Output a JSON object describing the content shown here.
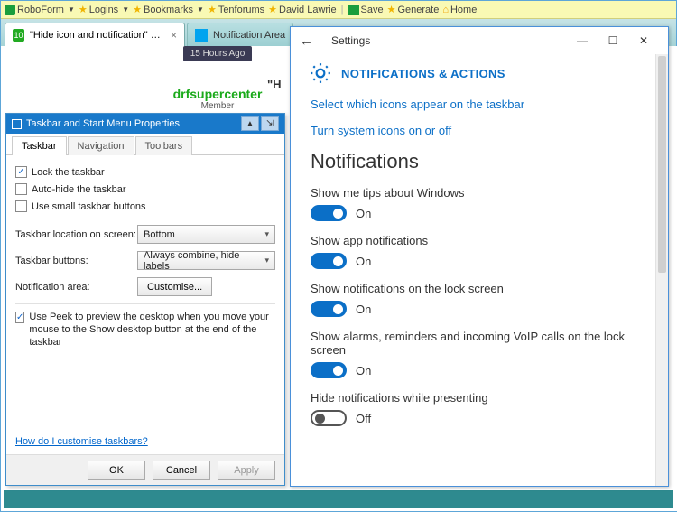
{
  "toolbar": {
    "items": [
      "RoboForm",
      "Logins",
      "Bookmarks",
      "Tenforums",
      "David Lawrie",
      "Save",
      "Generate",
      "Home"
    ]
  },
  "tabs": {
    "active": "\"Hide icon and notification\" optio...",
    "inactive": "Notification Area"
  },
  "forum": {
    "time": "15 Hours Ago",
    "user": "drfsupercenter",
    "role": "Member",
    "quote_prefix": "\"H"
  },
  "props": {
    "title": "Taskbar and Start Menu Properties",
    "tabs": [
      "Taskbar",
      "Navigation",
      "Toolbars"
    ],
    "lock": "Lock the taskbar",
    "autohide": "Auto-hide the taskbar",
    "small": "Use small taskbar buttons",
    "loc_label": "Taskbar location on screen:",
    "loc_value": "Bottom",
    "btns_label": "Taskbar buttons:",
    "btns_value": "Always combine, hide labels",
    "notif_label": "Notification area:",
    "notif_btn": "Customise...",
    "peek": "Use Peek to preview the desktop when you move your mouse to the Show desktop button at the end of the taskbar",
    "help": "How do I customise taskbars?",
    "ok": "OK",
    "cancel": "Cancel",
    "apply": "Apply"
  },
  "settings": {
    "title": "Settings",
    "category": "NOTIFICATIONS & ACTIONS",
    "link1": "Select which icons appear on the taskbar",
    "link2": "Turn system icons on or off",
    "section": "Notifications",
    "opts": [
      {
        "label": "Show me tips about Windows",
        "on": true,
        "state": "On"
      },
      {
        "label": "Show app notifications",
        "on": true,
        "state": "On"
      },
      {
        "label": "Show notifications on the lock screen",
        "on": true,
        "state": "On"
      },
      {
        "label": "Show alarms, reminders and incoming VoIP calls on the lock screen",
        "on": true,
        "state": "On"
      },
      {
        "label": "Hide notifications while presenting",
        "on": false,
        "state": "Off"
      }
    ]
  }
}
